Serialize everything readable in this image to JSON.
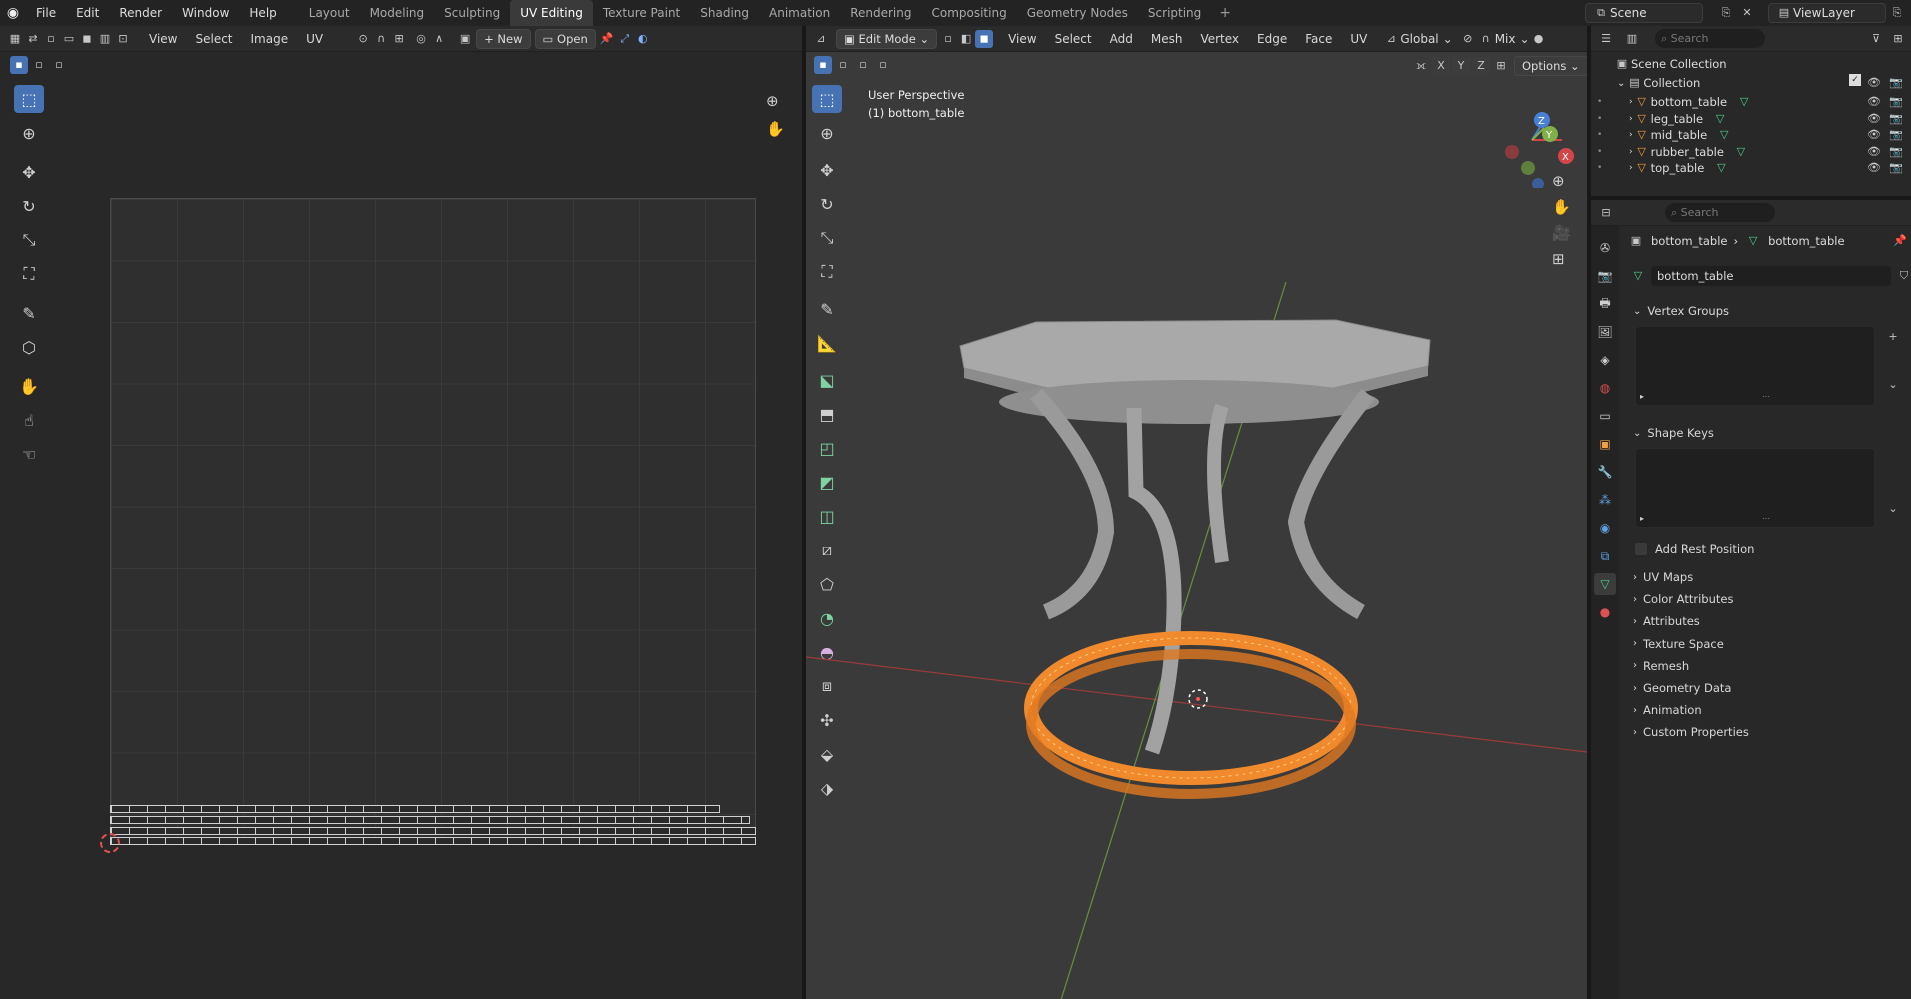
{
  "menu": [
    "File",
    "Edit",
    "Render",
    "Window",
    "Help"
  ],
  "workspaces": [
    "Layout",
    "Modeling",
    "Sculpting",
    "UV Editing",
    "Texture Paint",
    "Shading",
    "Animation",
    "Rendering",
    "Compositing",
    "Geometry Nodes",
    "Scripting"
  ],
  "active_workspace": "UV Editing",
  "scene": {
    "name": "Scene",
    "view_layer": "ViewLayer"
  },
  "uv_editor": {
    "menus": [
      "View",
      "Select",
      "Image",
      "UV"
    ],
    "new_label": "New",
    "open_label": "Open"
  },
  "viewport": {
    "mode": "Edit Mode",
    "menus": [
      "View",
      "Select",
      "Add",
      "Mesh",
      "Vertex",
      "Edge",
      "Face",
      "UV"
    ],
    "transform_orientation": "Global",
    "shading_mix": "Mix",
    "options_label": "Options",
    "axes": [
      "X",
      "Y",
      "Z"
    ],
    "info_line1": "User Perspective",
    "info_line2": "(1) bottom_table",
    "gizmo": {
      "x": "X",
      "y": "Y",
      "z": "Z"
    }
  },
  "outliner": {
    "search_placeholder": "Search",
    "scene_collection": "Scene Collection",
    "collection": "Collection",
    "objects": [
      "bottom_table",
      "leg_table",
      "mid_table",
      "rubber_table",
      "top_table"
    ]
  },
  "properties": {
    "search_placeholder": "Search",
    "breadcrumb_object": "bottom_table",
    "breadcrumb_data": "bottom_table",
    "mesh_name": "bottom_table",
    "vertex_groups": "Vertex Groups",
    "shape_keys": "Shape Keys",
    "add_rest_position": "Add Rest Position",
    "sections": [
      "UV Maps",
      "Color Attributes",
      "Attributes",
      "Texture Space",
      "Remesh",
      "Geometry Data",
      "Animation",
      "Custom Properties"
    ]
  },
  "colors": {
    "accent": "#4772b3",
    "selection": "#ff8a20",
    "x_axis": "#d64545",
    "y_axis": "#7fb04a",
    "z_axis": "#4a7fd6"
  }
}
